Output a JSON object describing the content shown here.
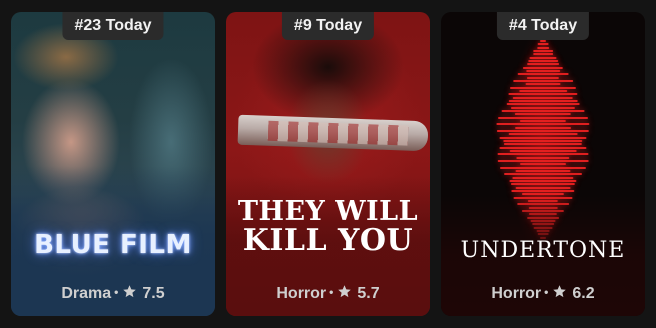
{
  "cards": [
    {
      "rank_label": "#23 Today",
      "title": "BLUE FILM",
      "genre": "Drama",
      "separator": "•",
      "rating": "7.5",
      "rating_icon": "star-icon"
    },
    {
      "rank_label": "#9 Today",
      "title_line1": "THEY WILL",
      "title_line2": "KILL YOU",
      "genre": "Horror",
      "separator": "•",
      "rating": "5.7",
      "rating_icon": "star-icon"
    },
    {
      "rank_label": "#4 Today",
      "title": "UNDERTONE",
      "genre": "Horror",
      "separator": "•",
      "rating": "6.2",
      "rating_icon": "star-icon"
    }
  ],
  "colors": {
    "background": "#141414",
    "badge": "#2b2b2b",
    "meta_text": "#cfcfcf"
  }
}
